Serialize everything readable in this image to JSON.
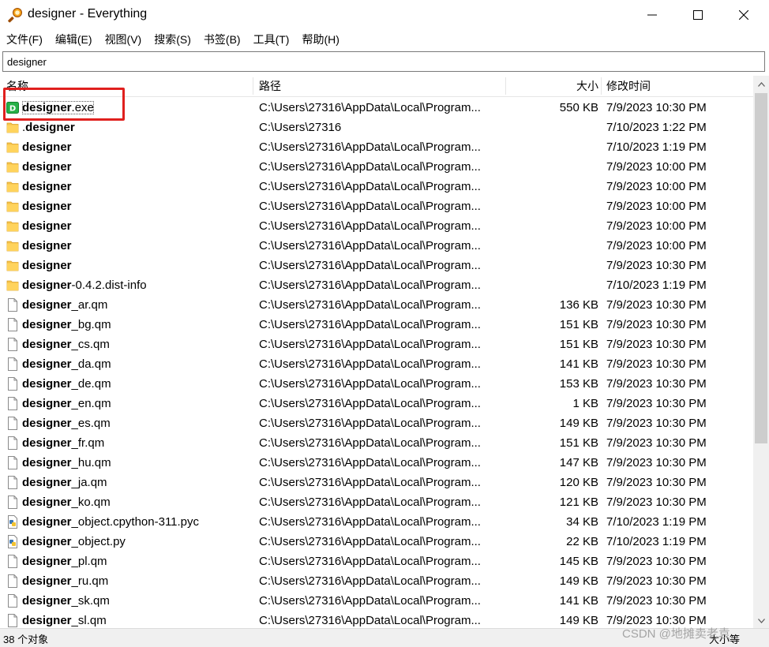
{
  "window": {
    "title": "designer - Everything",
    "controls": [
      "minimize-icon",
      "maximize-icon",
      "close-icon"
    ]
  },
  "menu": [
    "文件(F)",
    "编辑(E)",
    "视图(V)",
    "搜索(S)",
    "书签(B)",
    "工具(T)",
    "帮助(H)"
  ],
  "search": {
    "value": "designer",
    "placeholder": ""
  },
  "columns": {
    "name": "名称",
    "path": "路径",
    "size": "大小",
    "modified": "修改时间"
  },
  "highlight_term": "designer",
  "rows": [
    {
      "name": "designer.exe",
      "icon": "exe-icon",
      "path": "C:\\Users\\27316\\AppData\\Local\\Program...",
      "size": "550 KB",
      "modified": "7/9/2023 10:30 PM"
    },
    {
      "name": ".designer",
      "icon": "folder-icon",
      "path": "C:\\Users\\27316",
      "size": "",
      "modified": "7/10/2023 1:22 PM"
    },
    {
      "name": "designer",
      "icon": "folder-icon",
      "path": "C:\\Users\\27316\\AppData\\Local\\Program...",
      "size": "",
      "modified": "7/10/2023 1:19 PM"
    },
    {
      "name": "designer",
      "icon": "folder-icon",
      "path": "C:\\Users\\27316\\AppData\\Local\\Program...",
      "size": "",
      "modified": "7/9/2023 10:00 PM"
    },
    {
      "name": "designer",
      "icon": "folder-icon",
      "path": "C:\\Users\\27316\\AppData\\Local\\Program...",
      "size": "",
      "modified": "7/9/2023 10:00 PM"
    },
    {
      "name": "designer",
      "icon": "folder-icon",
      "path": "C:\\Users\\27316\\AppData\\Local\\Program...",
      "size": "",
      "modified": "7/9/2023 10:00 PM"
    },
    {
      "name": "designer",
      "icon": "folder-icon",
      "path": "C:\\Users\\27316\\AppData\\Local\\Program...",
      "size": "",
      "modified": "7/9/2023 10:00 PM"
    },
    {
      "name": "designer",
      "icon": "folder-icon",
      "path": "C:\\Users\\27316\\AppData\\Local\\Program...",
      "size": "",
      "modified": "7/9/2023 10:00 PM"
    },
    {
      "name": "designer",
      "icon": "folder-icon",
      "path": "C:\\Users\\27316\\AppData\\Local\\Program...",
      "size": "",
      "modified": "7/9/2023 10:30 PM"
    },
    {
      "name": "designer-0.4.2.dist-info",
      "icon": "folder-icon",
      "path": "C:\\Users\\27316\\AppData\\Local\\Program...",
      "size": "",
      "modified": "7/10/2023 1:19 PM"
    },
    {
      "name": "designer_ar.qm",
      "icon": "file-icon",
      "path": "C:\\Users\\27316\\AppData\\Local\\Program...",
      "size": "136 KB",
      "modified": "7/9/2023 10:30 PM"
    },
    {
      "name": "designer_bg.qm",
      "icon": "file-icon",
      "path": "C:\\Users\\27316\\AppData\\Local\\Program...",
      "size": "151 KB",
      "modified": "7/9/2023 10:30 PM"
    },
    {
      "name": "designer_cs.qm",
      "icon": "file-icon",
      "path": "C:\\Users\\27316\\AppData\\Local\\Program...",
      "size": "151 KB",
      "modified": "7/9/2023 10:30 PM"
    },
    {
      "name": "designer_da.qm",
      "icon": "file-icon",
      "path": "C:\\Users\\27316\\AppData\\Local\\Program...",
      "size": "141 KB",
      "modified": "7/9/2023 10:30 PM"
    },
    {
      "name": "designer_de.qm",
      "icon": "file-icon",
      "path": "C:\\Users\\27316\\AppData\\Local\\Program...",
      "size": "153 KB",
      "modified": "7/9/2023 10:30 PM"
    },
    {
      "name": "designer_en.qm",
      "icon": "file-icon",
      "path": "C:\\Users\\27316\\AppData\\Local\\Program...",
      "size": "1 KB",
      "modified": "7/9/2023 10:30 PM"
    },
    {
      "name": "designer_es.qm",
      "icon": "file-icon",
      "path": "C:\\Users\\27316\\AppData\\Local\\Program...",
      "size": "149 KB",
      "modified": "7/9/2023 10:30 PM"
    },
    {
      "name": "designer_fr.qm",
      "icon": "file-icon",
      "path": "C:\\Users\\27316\\AppData\\Local\\Program...",
      "size": "151 KB",
      "modified": "7/9/2023 10:30 PM"
    },
    {
      "name": "designer_hu.qm",
      "icon": "file-icon",
      "path": "C:\\Users\\27316\\AppData\\Local\\Program...",
      "size": "147 KB",
      "modified": "7/9/2023 10:30 PM"
    },
    {
      "name": "designer_ja.qm",
      "icon": "file-icon",
      "path": "C:\\Users\\27316\\AppData\\Local\\Program...",
      "size": "120 KB",
      "modified": "7/9/2023 10:30 PM"
    },
    {
      "name": "designer_ko.qm",
      "icon": "file-icon",
      "path": "C:\\Users\\27316\\AppData\\Local\\Program...",
      "size": "121 KB",
      "modified": "7/9/2023 10:30 PM"
    },
    {
      "name": "designer_object.cpython-311.pyc",
      "icon": "pyc-file-icon",
      "path": "C:\\Users\\27316\\AppData\\Local\\Program...",
      "size": "34 KB",
      "modified": "7/10/2023 1:19 PM"
    },
    {
      "name": "designer_object.py",
      "icon": "python-file-icon",
      "path": "C:\\Users\\27316\\AppData\\Local\\Program...",
      "size": "22 KB",
      "modified": "7/10/2023 1:19 PM"
    },
    {
      "name": "designer_pl.qm",
      "icon": "file-icon",
      "path": "C:\\Users\\27316\\AppData\\Local\\Program...",
      "size": "145 KB",
      "modified": "7/9/2023 10:30 PM"
    },
    {
      "name": "designer_ru.qm",
      "icon": "file-icon",
      "path": "C:\\Users\\27316\\AppData\\Local\\Program...",
      "size": "149 KB",
      "modified": "7/9/2023 10:30 PM"
    },
    {
      "name": "designer_sk.qm",
      "icon": "file-icon",
      "path": "C:\\Users\\27316\\AppData\\Local\\Program...",
      "size": "141 KB",
      "modified": "7/9/2023 10:30 PM"
    },
    {
      "name": "designer_sl.qm",
      "icon": "file-icon",
      "path": "C:\\Users\\27316\\AppData\\Local\\Program...",
      "size": "149 KB",
      "modified": "7/9/2023 10:30 PM"
    }
  ],
  "status": {
    "count": "38 个对象",
    "right": "大小等"
  },
  "watermark": "CSDN @地摊卖老袁",
  "colors": {
    "annotation": "#e0201e",
    "folder": "#f4c24a",
    "exe": "#27b148",
    "statusbar": "#f0f0f0"
  }
}
